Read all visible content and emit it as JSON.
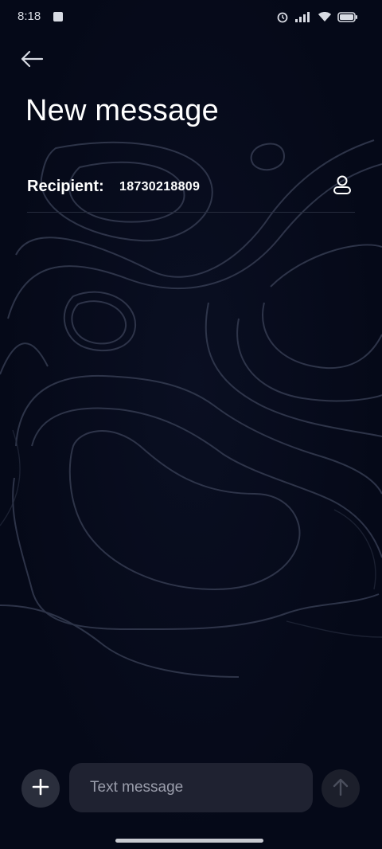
{
  "status_bar": {
    "time": "8:18",
    "left_icon": "notification-icon",
    "right_icons": [
      "alarm-icon",
      "signal-icon",
      "wifi-icon",
      "battery-icon"
    ]
  },
  "header": {
    "back_icon": "arrow-left-icon",
    "title": "New message"
  },
  "recipient": {
    "label": "Recipient:",
    "value": "18730218809",
    "contact_icon": "person-icon"
  },
  "composer": {
    "attach_icon": "plus-icon",
    "placeholder": "Text message",
    "value": "",
    "send_icon": "arrow-up-icon"
  },
  "colors": {
    "background": "#050918",
    "field": "#1f2231",
    "attach_button": "#2a2e3c",
    "send_button": "#1c1f2b",
    "divider": "#262c3d",
    "text": "#ffffff",
    "placeholder": "#9a9dab"
  }
}
